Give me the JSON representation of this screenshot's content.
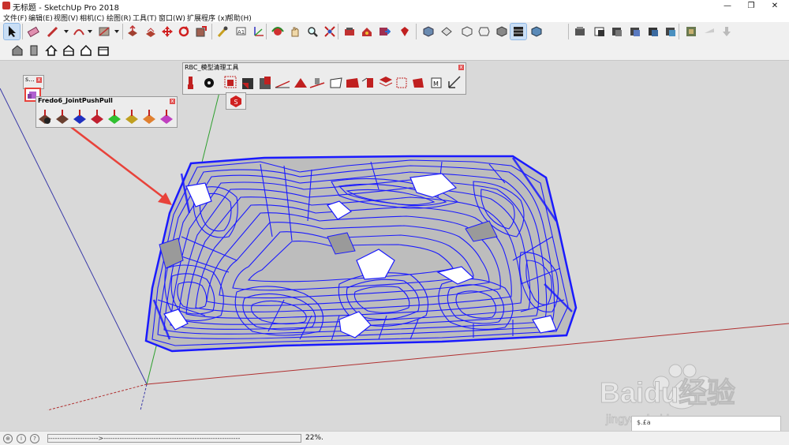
{
  "window": {
    "title": "无标题 - SketchUp Pro 2018",
    "minimize": "—",
    "maximize": "❐",
    "close": "✕"
  },
  "menu": [
    "文件(F)",
    "编辑(E)",
    "视图(V)",
    "相机(C)",
    "绘图(R)",
    "工具(T)",
    "窗口(W)",
    "扩展程序 (x)",
    "帮助(H)"
  ],
  "toolbar1_icons": [
    "select-icon",
    "eraser-icon",
    "pencil-icon",
    "arc-icon",
    "shape-icon",
    "push-pull-icon",
    "move-icon",
    "rotate-icon",
    "scale-icon",
    "tape-measure-icon",
    "text-icon",
    "orbit-icon",
    "pan-icon",
    "zoom-icon",
    "zoom-extents-icon",
    "component-icon",
    "3d-warehouse-icon",
    "extension-warehouse-icon",
    "ruby-icon",
    "iso-view-icon",
    "top-view-icon",
    "front-view-icon",
    "right-view-icon",
    "back-view-icon",
    "left-view-icon",
    "xray-icon",
    "shaded-icon",
    "style-icon",
    "style2-icon",
    "style3-icon",
    "style4-icon",
    "style5-icon",
    "section-icon",
    "import-icon",
    "export-icon"
  ],
  "toolbar2_icons": [
    "warehouse-icon",
    "door-icon",
    "house-icon",
    "house2-icon",
    "house3-icon",
    "house4-icon"
  ],
  "panels": {
    "s_panel": {
      "title": "s..."
    },
    "fredo": {
      "title": "Fredo6_JointPushPull"
    },
    "rbc": {
      "title": "RBC_模型清理工具"
    }
  },
  "status": {
    "progress_text": "---------------------->------------------------------------------------------------",
    "zoom": "22%."
  },
  "measurements_label": "$.£a",
  "watermark": {
    "brand": "Baidu经验",
    "url": "jingyan.baidu.com"
  },
  "colors": {
    "terrain_contour": "#1a1aff",
    "red_axis": "#b03030",
    "green_axis": "#2ea02e",
    "blue_axis": "#3030b0",
    "arrow": "#e8423a"
  }
}
